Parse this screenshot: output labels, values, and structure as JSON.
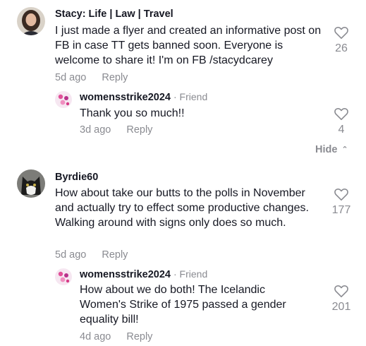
{
  "comments": [
    {
      "username": "Stacy: Life | Law | Travel",
      "text": "I just made a flyer and created an informative post on FB in case TT gets banned soon. Everyone is welcome to share it! I'm on FB /stacydcarey",
      "time": "5d ago",
      "reply_label": "Reply",
      "likes": "26",
      "replies": [
        {
          "username": "womensstrike2024",
          "tag": "· Friend",
          "text": "Thank you so much!!",
          "time": "3d ago",
          "reply_label": "Reply",
          "likes": "4"
        }
      ],
      "hide_label": "Hide"
    },
    {
      "username": "Byrdie60",
      "text": "How about take our butts to the polls in November and actually try to effect some productive changes. Walking around with signs only does so much.",
      "time": "5d ago",
      "reply_label": "Reply",
      "likes": "177",
      "replies": [
        {
          "username": "womensstrike2024",
          "tag": "· Friend",
          "text": "How about we do both! The Icelandic Women's Strike of 1975 passed a gender equality bill!",
          "time": "4d ago",
          "reply_label": "Reply",
          "likes": "201"
        }
      ]
    }
  ],
  "icons": {
    "like": "heart-outline-icon",
    "hide": "chevron-up-icon"
  },
  "colors": {
    "text": "#161823",
    "muted": "#8a8b91"
  }
}
